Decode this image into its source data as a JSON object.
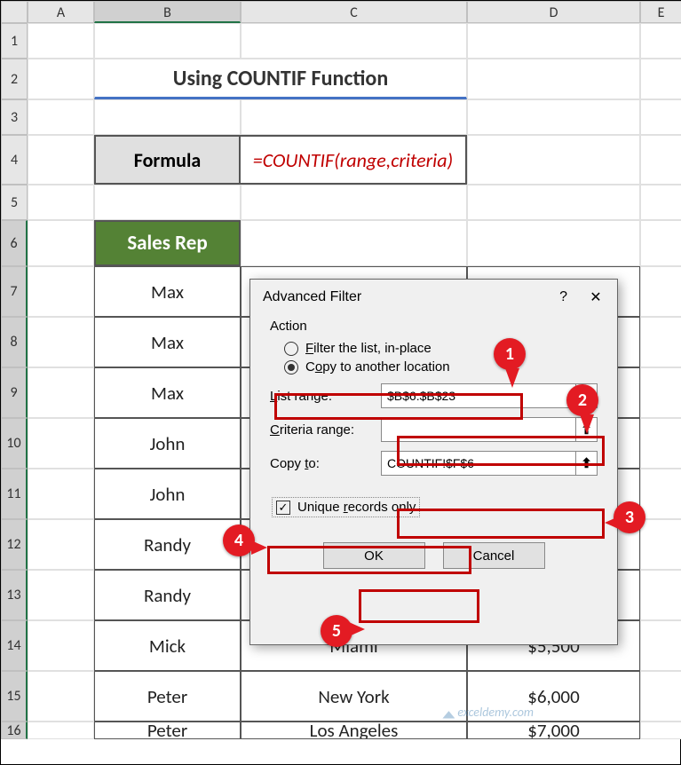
{
  "columns": [
    "A",
    "B",
    "C",
    "D",
    "E"
  ],
  "rows": [
    "1",
    "2",
    "3",
    "4",
    "5",
    "6",
    "7",
    "8",
    "9",
    "10",
    "11",
    "12",
    "13",
    "14",
    "15",
    "16"
  ],
  "title": "Using COUNTIF Function",
  "formula": {
    "label": "Formula",
    "value": "=COUNTIF(range,criteria)"
  },
  "table": {
    "header": "Sales Rep",
    "reps": [
      "Max",
      "Max",
      "Max",
      "John",
      "John",
      "Randy",
      "Randy",
      "Mick",
      "Peter",
      "Peter"
    ],
    "cities": [
      "",
      "",
      "",
      "",
      "",
      "",
      "",
      "Miami",
      "New York",
      "Los Angeles"
    ],
    "amounts": [
      "",
      "",
      "",
      "",
      "",
      "",
      "",
      "$5,500",
      "$6,000",
      "$7,000"
    ]
  },
  "dialog": {
    "title": "Advanced Filter",
    "help": "?",
    "close": "✕",
    "action_label": "Action",
    "radio1": "Filter the list, in-place",
    "radio2": "Copy to another location",
    "list_range_label": "List range:",
    "list_range_value": "$B$6:$B$23",
    "criteria_range_label": "Criteria range:",
    "criteria_range_value": "",
    "copy_to_label": "Copy to:",
    "copy_to_value": "COUNTIF!$F$6",
    "unique_label": "Unique records only",
    "ok": "OK",
    "cancel": "Cancel",
    "picker": "⬆"
  },
  "callouts": {
    "c1": "1",
    "c2": "2",
    "c3": "3",
    "c4": "4",
    "c5": "5"
  },
  "watermark": "exceldemy.com"
}
